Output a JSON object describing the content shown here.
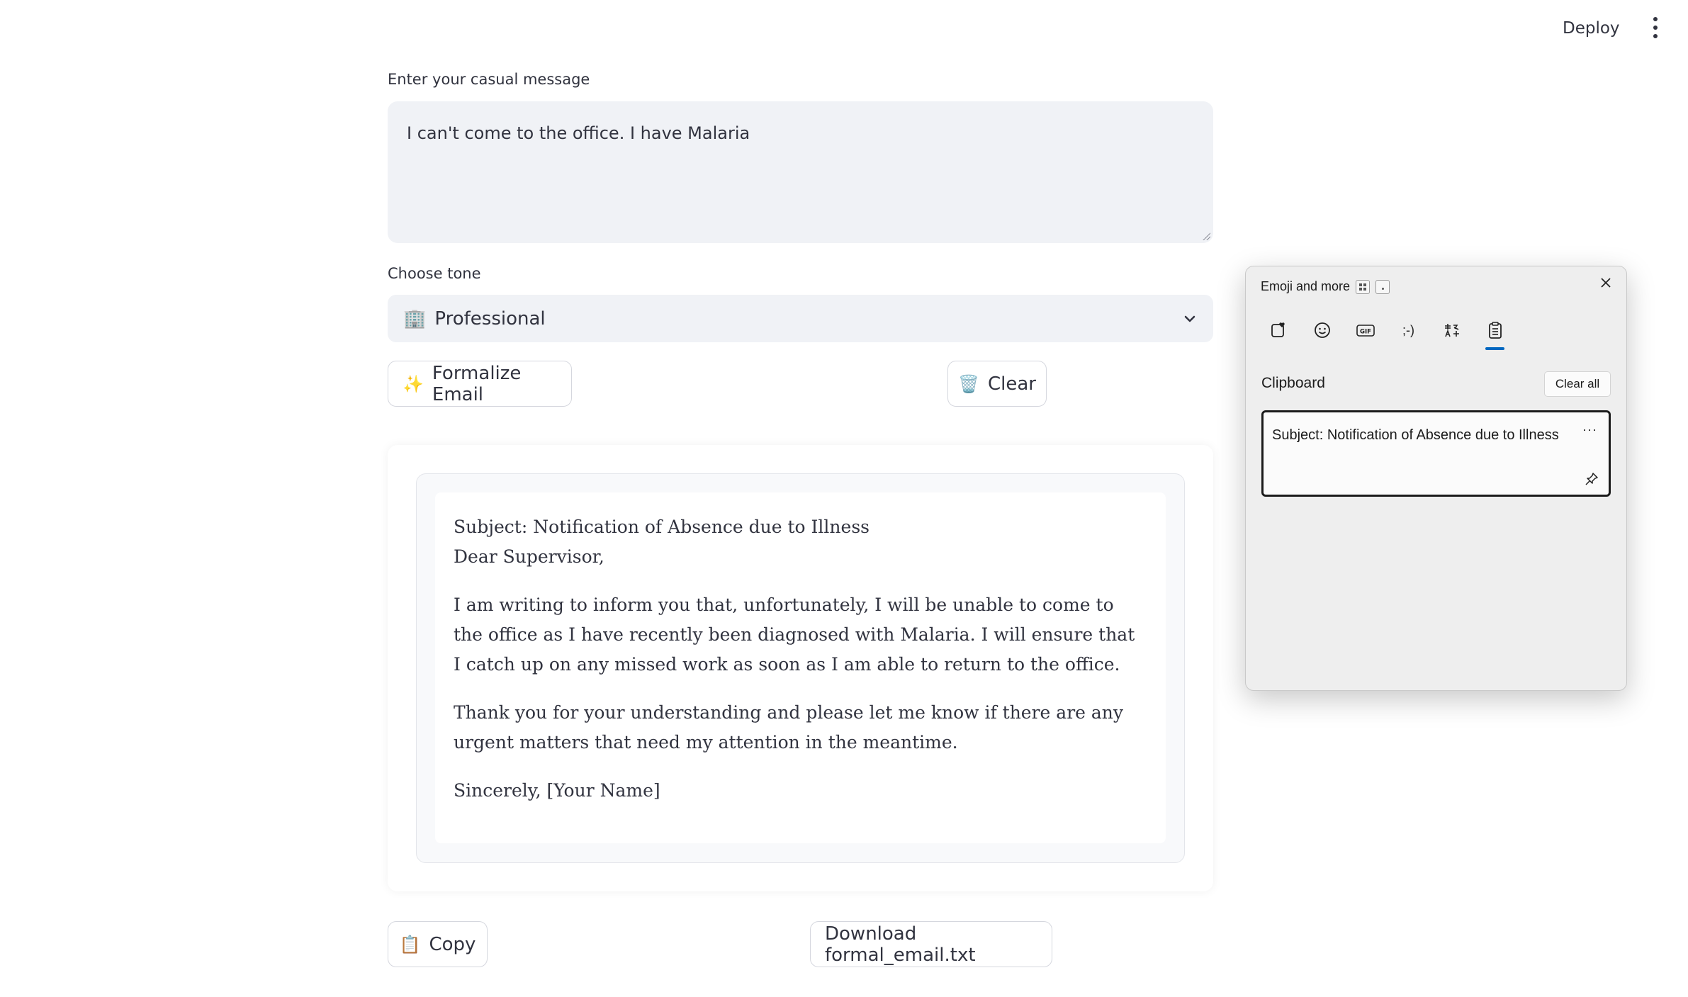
{
  "header": {
    "deploy_label": "Deploy",
    "menu_icon": "kebab-menu-icon"
  },
  "message": {
    "label": "Enter your casual message",
    "value": "I can't come to the office. I have Malaria"
  },
  "tone": {
    "label": "Choose tone",
    "selected_emoji": "🏢",
    "selected": "Professional"
  },
  "actions": {
    "formalize_emoji": "✨",
    "formalize_label": "Formalize Email",
    "clear_emoji": "🗑️",
    "clear_label": "Clear"
  },
  "email": {
    "subject": "Subject: Notification of Absence due to Illness",
    "greeting": "Dear Supervisor,",
    "paragraph1": "I am writing to inform you that, unfortunately, I will be unable to come to the office as I have recently been diagnosed with Malaria. I will ensure that I catch up on any missed work as soon as I am able to return to the office.",
    "paragraph2": "Thank you for your understanding and please let me know if there are any urgent matters that need my attention in the meantime.",
    "signoff": "Sincerely, [Your Name]"
  },
  "bottom": {
    "copy_emoji": "📋",
    "copy_label": "Copy",
    "download_label": "Download formal_email.txt"
  },
  "emoji_panel": {
    "title": "Emoji and more",
    "tabs": [
      {
        "name": "favorites-icon",
        "label": ""
      },
      {
        "name": "emoji-icon",
        "label": ""
      },
      {
        "name": "gif-icon",
        "label": "GIF"
      },
      {
        "name": "kaomoji-icon",
        "label": ";-)"
      },
      {
        "name": "symbols-icon",
        "label": ""
      },
      {
        "name": "clipboard-icon",
        "label": ""
      }
    ],
    "section_title": "Clipboard",
    "clear_all_label": "Clear all",
    "clip_items": [
      "Subject: Notification of Absence due to Illness"
    ],
    "more_label": "···"
  },
  "colors": {
    "accent": "#0067c0",
    "input_bg": "#f0f2f6",
    "text": "#31333f"
  }
}
